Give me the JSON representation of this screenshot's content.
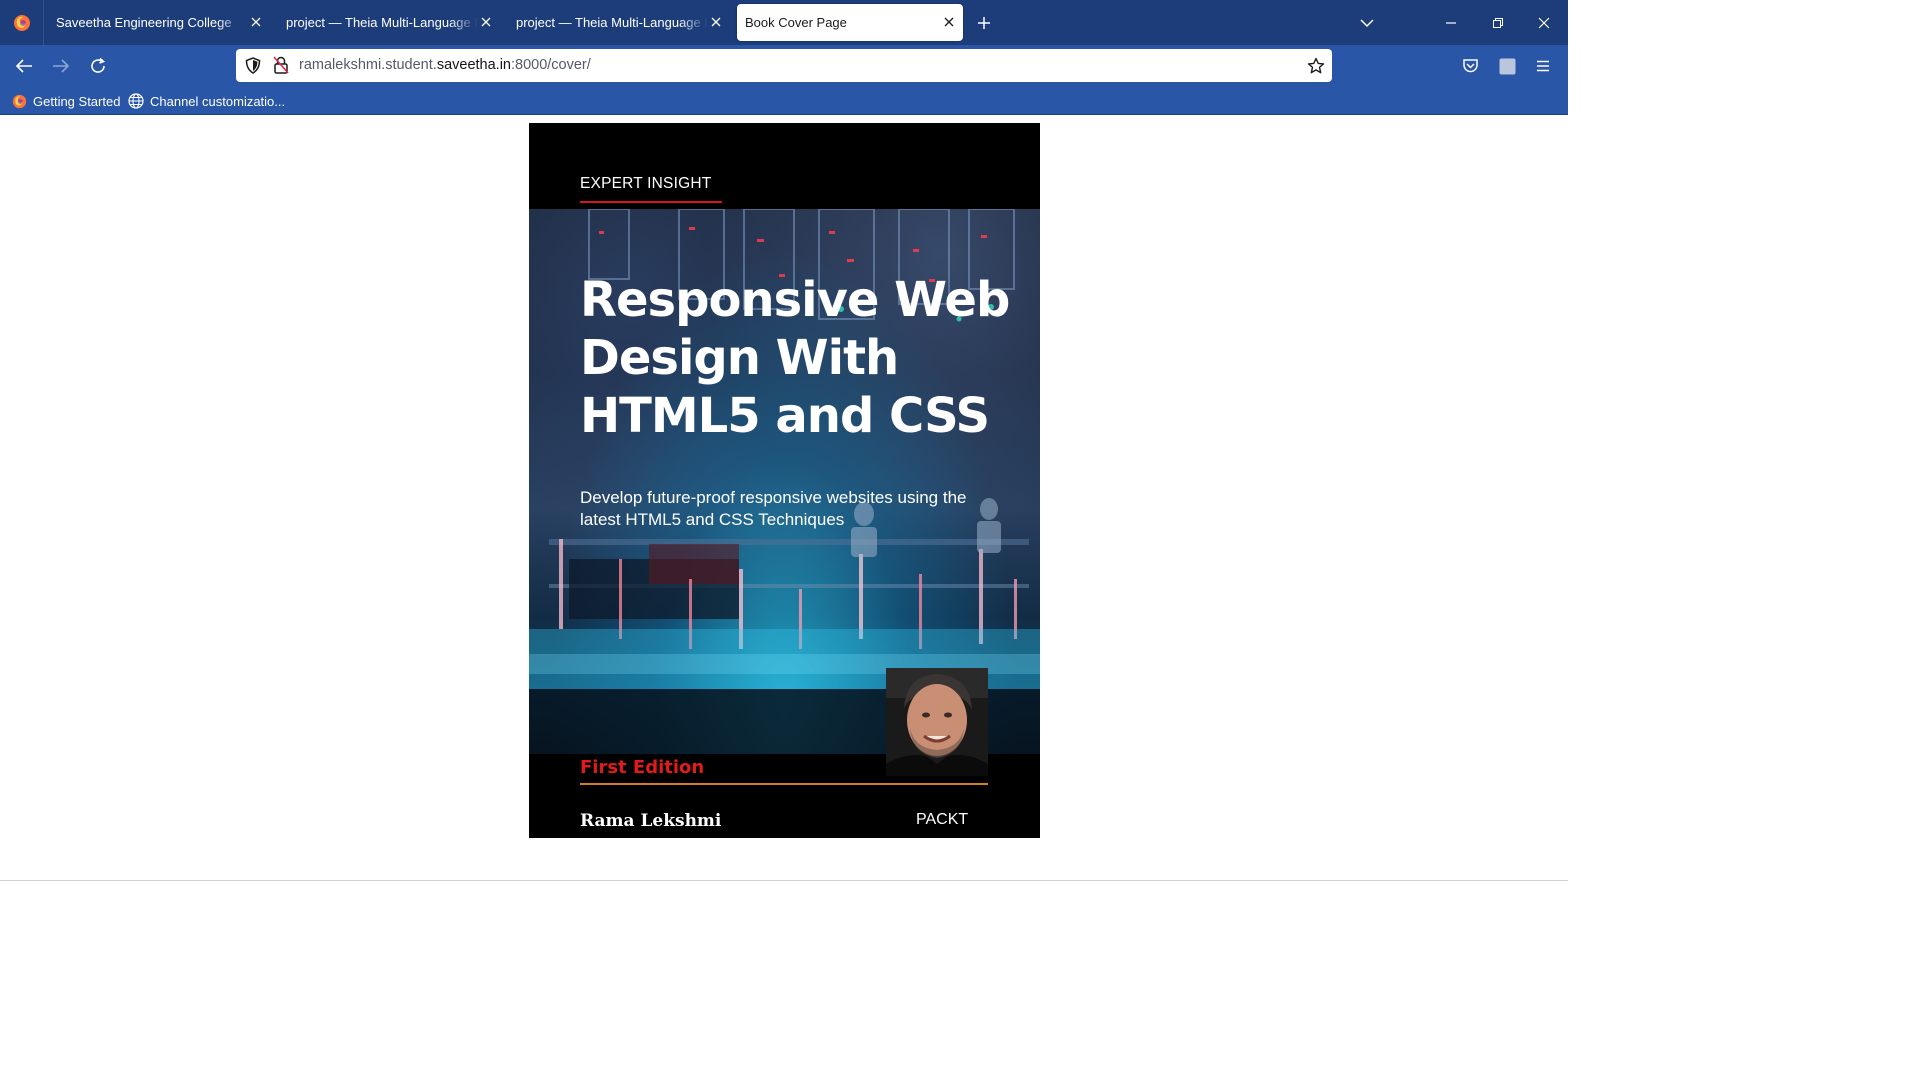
{
  "browser": {
    "tabs": [
      {
        "title": "Saveetha Engineering College",
        "active": false
      },
      {
        "title": "project — Theia Multi-Language Ex",
        "active": false
      },
      {
        "title": "project — Theia Multi-Language Ex",
        "active": false
      },
      {
        "title": "Book Cover Page",
        "active": true
      }
    ],
    "url": {
      "prefix": "ramalekshmi.student.",
      "host": "saveetha.in",
      "suffix": ":8000/cover/"
    },
    "bookmarks": [
      {
        "label": "Getting Started",
        "icon": "firefox-icon"
      },
      {
        "label": "Channel customizatio...",
        "icon": "globe-icon"
      }
    ],
    "colors": {
      "tabstrip": "#1c3d7a",
      "toolbar": "#2a56a8"
    }
  },
  "cover": {
    "eyebrow": "EXPERT INSIGHT",
    "title_lines": [
      "Responsive Web",
      "Design With",
      "HTML5 and CSS"
    ],
    "subtitle": "Develop future-proof responsive websites using the latest HTML5 and CSS Techniques",
    "edition": "First Edition",
    "author": "Rama Lekshmi",
    "publisher": "PACKT",
    "colors": {
      "accent_red": "#d5161c",
      "edition_red": "#e01b1b",
      "rule_orange": "#d4801c",
      "background": "#000000"
    }
  }
}
